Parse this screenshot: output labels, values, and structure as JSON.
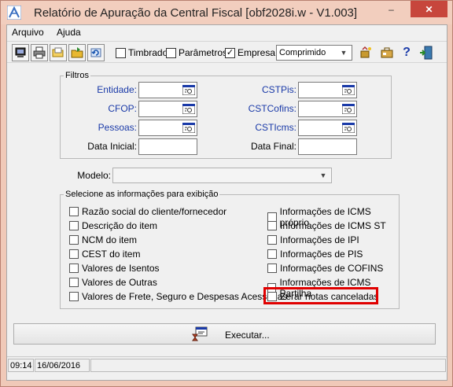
{
  "window": {
    "title": "Relatório de Apuração da Central Fiscal [obf2028i.w - V1.003]",
    "minimize_glyph": "–",
    "maximize_glyph": "□",
    "close_glyph": "✕"
  },
  "menu": {
    "items": [
      "Arquivo",
      "Ajuda"
    ]
  },
  "toolbar": {
    "checkboxes": [
      {
        "label": "Timbrado",
        "checked": false
      },
      {
        "label": "Parâmetros",
        "checked": false
      },
      {
        "label": "Empresa",
        "checked": true
      }
    ],
    "check_glyph": "✓",
    "format_select": "Comprimido",
    "help_glyph": "?"
  },
  "filtros": {
    "legend": "Filtros",
    "left": [
      {
        "label": "Entidade:",
        "value": ""
      },
      {
        "label": "CFOP:",
        "value": ""
      },
      {
        "label": "Pessoas:",
        "value": ""
      },
      {
        "label": "Data Inicial:",
        "value": ""
      }
    ],
    "right": [
      {
        "label": "CSTPis:",
        "value": ""
      },
      {
        "label": "CSTCofins:",
        "value": ""
      },
      {
        "label": "CSTIcms:",
        "value": ""
      },
      {
        "label": "Data Final:",
        "value": ""
      }
    ]
  },
  "modelo": {
    "label": "Modelo:",
    "value": ""
  },
  "selecao": {
    "legend": "Selecione as informações para exibição",
    "left": [
      {
        "label": "Razão social do cliente/fornecedor",
        "checked": false
      },
      {
        "label": "Descrição do item",
        "checked": false
      },
      {
        "label": "NCM do item",
        "checked": false
      },
      {
        "label": "CEST do item",
        "checked": false
      },
      {
        "label": "Valores de Isentos",
        "checked": false
      },
      {
        "label": "Valores de Outras",
        "checked": false
      },
      {
        "label": "Valores de Frete, Seguro e Despesas Acessórias",
        "checked": false
      }
    ],
    "right": [
      {
        "label": "Informações de ICMS próprio",
        "checked": false
      },
      {
        "label": "Informações de ICMS ST",
        "checked": false
      },
      {
        "label": "Informações de IPI",
        "checked": false
      },
      {
        "label": "Informações de PIS",
        "checked": false
      },
      {
        "label": "Informações de COFINS",
        "checked": false
      },
      {
        "label": "Informações de ICMS Partilha",
        "checked": false
      },
      {
        "label": "Zerar notas canceladas",
        "checked": false
      }
    ]
  },
  "execute_label": "Executar...",
  "status": {
    "time": "09:14",
    "date": "16/06/2016"
  },
  "colors": {
    "highlight": "#e00000",
    "label_blue": "#1a3aa8",
    "title_bg": "#f2cebe"
  }
}
